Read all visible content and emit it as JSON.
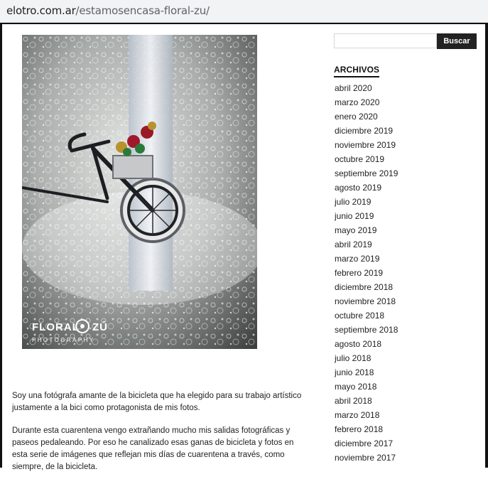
{
  "browser": {
    "url_host": "elotro.com.ar",
    "url_path": "/estamosencasa-floral-zu/"
  },
  "post": {
    "photo_brand": "FLORAL",
    "photo_brand_2": "ZÚ",
    "photo_subtitle": "PHOTOGRAPHY",
    "paragraph_1": "Soy una fotógrafa amante de la bicicleta que ha elegido para su trabajo artístico justamente a la bici como protagonista de mis fotos.",
    "paragraph_2": "Durante esta cuarentena vengo extrañando mucho mis salidas fotográficas y paseos pedaleando. Por eso he canalizado esas ganas de bicicleta y fotos en esta serie de imágenes que reflejan mis días de cuarentena a través, como siempre, de la bicicleta."
  },
  "sidebar": {
    "search_placeholder": "",
    "search_button": "Buscar",
    "archives_title": "ARCHIVOS",
    "archives": [
      "abril 2020",
      "marzo 2020",
      "enero 2020",
      "diciembre 2019",
      "noviembre 2019",
      "octubre 2019",
      "septiembre 2019",
      "agosto 2019",
      "julio 2019",
      "junio 2019",
      "mayo 2019",
      "abril 2019",
      "marzo 2019",
      "febrero 2019",
      "diciembre 2018",
      "noviembre 2018",
      "octubre 2018",
      "septiembre 2018",
      "agosto 2018",
      "julio 2018",
      "junio 2018",
      "mayo 2018",
      "abril 2018",
      "marzo 2018",
      "febrero 2018",
      "diciembre 2017",
      "noviembre 2017"
    ]
  }
}
